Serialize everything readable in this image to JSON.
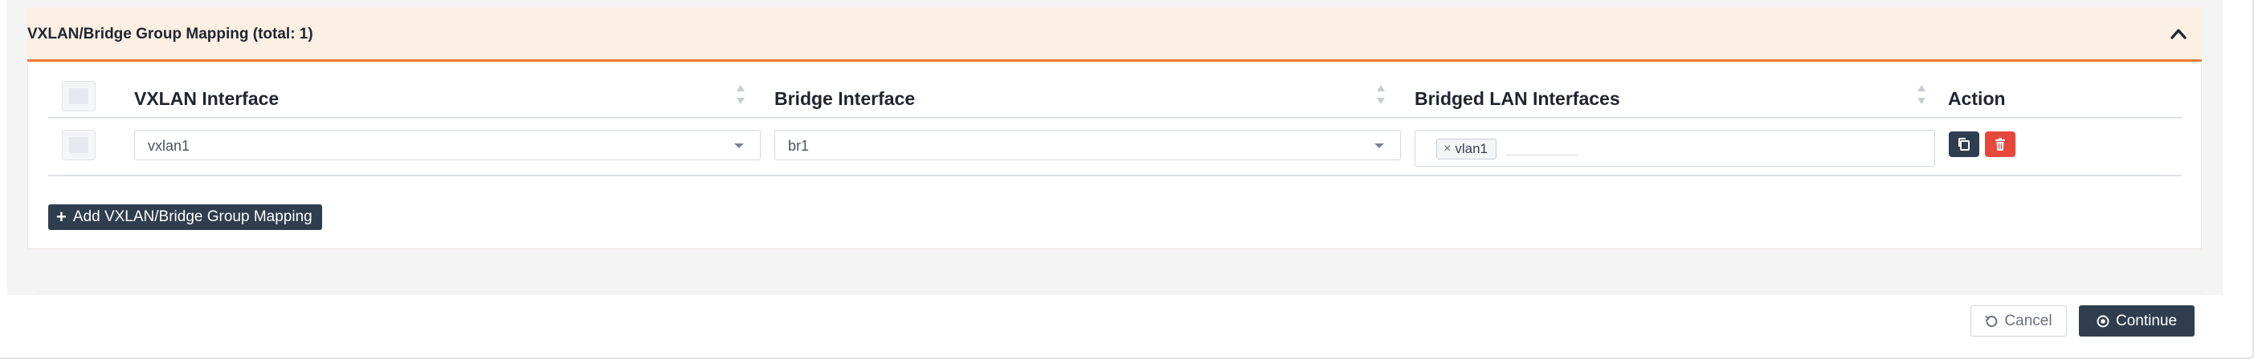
{
  "panel": {
    "title": "VXLAN/Bridge Group Mapping (total: 1)",
    "collapse_icon": "chevron-up-icon"
  },
  "table": {
    "columns": {
      "vxlan_interface": "VXLAN Interface",
      "bridge_interface": "Bridge Interface",
      "bridged_lan_interfaces": "Bridged LAN Interfaces",
      "action": "Action"
    },
    "rows": [
      {
        "vxlan_interface": "vxlan1",
        "bridge_interface": "br1",
        "bridged_lan_interfaces": [
          "vlan1"
        ],
        "actions": [
          "copy-icon",
          "trash-icon"
        ]
      }
    ]
  },
  "add_button": {
    "icon": "plus-icon",
    "label": "Add VXLAN/Bridge Group Mapping"
  },
  "footer": {
    "cancel_label": "Cancel",
    "cancel_icon": "undo-icon",
    "continue_label": "Continue",
    "continue_icon": "circle-dot-icon"
  },
  "colors": {
    "accent": "#ee7b3a",
    "header_bg": "#fcefe4",
    "dark_button": "#2f3d4f",
    "danger_button": "#e8473b"
  }
}
